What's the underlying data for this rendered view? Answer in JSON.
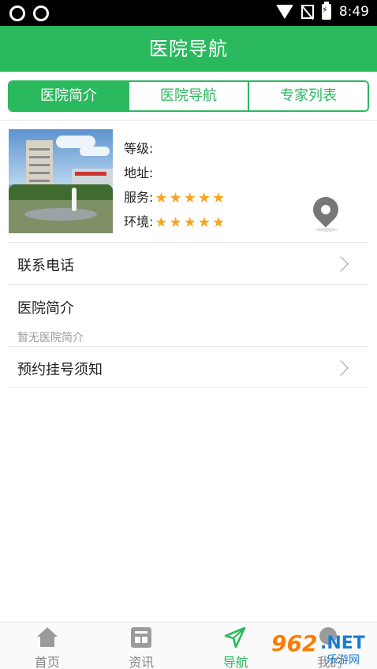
{
  "status_bar": {
    "time": "8:49",
    "icons": [
      "sync-icon",
      "sync-icon",
      "wifi-icon",
      "no-signal-icon",
      "battery-charging-icon"
    ]
  },
  "header": {
    "title": "医院导航"
  },
  "tabs": [
    {
      "label": "医院简介",
      "active": true
    },
    {
      "label": "医院导航",
      "active": false
    },
    {
      "label": "专家列表",
      "active": false
    }
  ],
  "hospital": {
    "level_label": "等级:",
    "address_label": "地址:",
    "service_label": "服务:",
    "service_rating": 5,
    "environment_label": "环境:",
    "environment_rating": 5,
    "photo_icon": "hospital-photo",
    "map_icon": "location-pin-icon"
  },
  "list": {
    "phone_label": "联系电话",
    "intro_label": "医院简介",
    "intro_note": "暂无医院简介",
    "booking_label": "预约挂号须知"
  },
  "bottom_nav": [
    {
      "label": "首页",
      "icon": "home-icon",
      "active": false
    },
    {
      "label": "资讯",
      "icon": "news-icon",
      "active": false
    },
    {
      "label": "导航",
      "icon": "navigation-icon",
      "active": true
    },
    {
      "label": "我的",
      "icon": "profile-icon",
      "active": false
    }
  ],
  "watermark": {
    "number": "962",
    "suffix": ".NET",
    "text": "乐游网"
  },
  "colors": {
    "primary": "#2ab95d",
    "star": "#f5a623",
    "text": "#222222",
    "muted": "#999999"
  }
}
